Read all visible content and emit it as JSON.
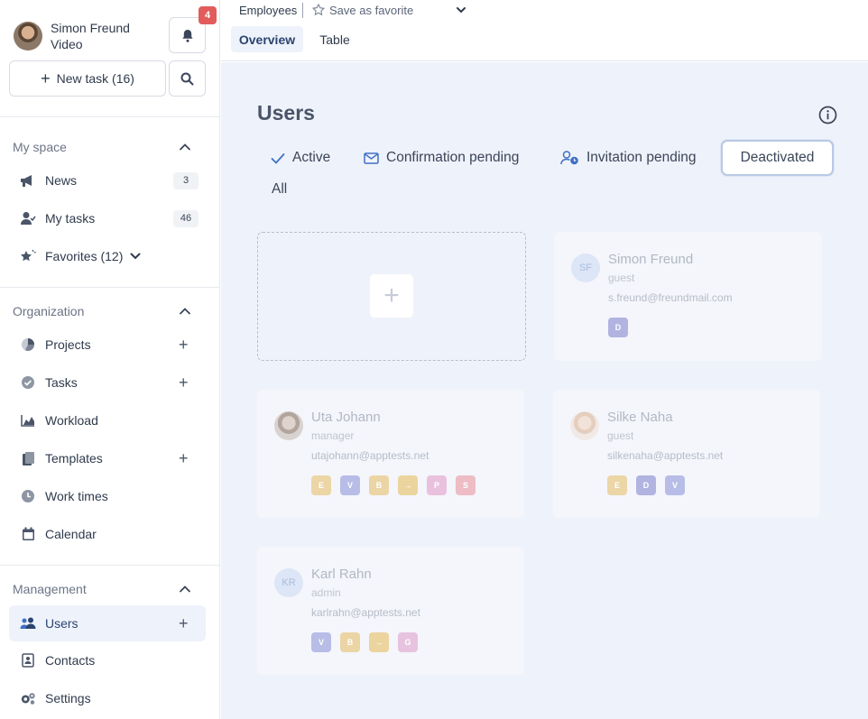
{
  "profile": {
    "name": "Simon Freund",
    "subtitle": "Video"
  },
  "notifications": {
    "count": "4"
  },
  "new_task_label": "New task (16)",
  "sections": {
    "my_space": "My space",
    "organization": "Organization",
    "management": "Management"
  },
  "nav": {
    "news": {
      "label": "News",
      "count": "3"
    },
    "my_tasks": {
      "label": "My tasks",
      "count": "46"
    },
    "favorites": {
      "label": "Favorites (12)"
    },
    "projects": {
      "label": "Projects"
    },
    "tasks": {
      "label": "Tasks"
    },
    "workload": {
      "label": "Workload"
    },
    "templates": {
      "label": "Templates"
    },
    "work_times": {
      "label": "Work times"
    },
    "calendar": {
      "label": "Calendar"
    },
    "users": {
      "label": "Users"
    },
    "contacts": {
      "label": "Contacts"
    },
    "settings": {
      "label": "Settings"
    }
  },
  "header": {
    "breadcrumb": "Employees",
    "save_favorite": "Save as favorite",
    "tabs": [
      "Overview",
      "Table"
    ]
  },
  "page": {
    "title": "Users",
    "filters": {
      "active": "Active",
      "confirmation_pending": "Confirmation pending",
      "invitation_pending": "Invitation pending",
      "deactivated": "Deactivated",
      "all": "All"
    }
  },
  "users": [
    {
      "initials": "SF",
      "name": "Simon Freund",
      "role": "guest",
      "email": "s.freund@freundmail.com",
      "chips": [
        {
          "letter": "D",
          "color": "#b1b4e0"
        }
      ]
    },
    {
      "initials": "",
      "name": "Uta Johann",
      "role": "manager",
      "email": "utajohann@apptests.net",
      "chips": [
        {
          "letter": "E",
          "color": "#ecd6a6"
        },
        {
          "letter": "V",
          "color": "#b7bde6"
        },
        {
          "letter": "B",
          "color": "#ebd5a5"
        },
        {
          "letter": "→",
          "color": "#ebd49e"
        },
        {
          "letter": "P",
          "color": "#e9c1df"
        },
        {
          "letter": "S",
          "color": "#eebcc4"
        }
      ]
    },
    {
      "initials": "",
      "name": "Silke Naha",
      "role": "guest",
      "email": "silkenaha@apptests.net",
      "chips": [
        {
          "letter": "E",
          "color": "#ecd6a6"
        },
        {
          "letter": "D",
          "color": "#b1b4e0"
        },
        {
          "letter": "V",
          "color": "#b7bde6"
        }
      ]
    },
    {
      "initials": "KR",
      "name": "Karl Rahn",
      "role": "admin",
      "email": "karlrahn@apptests.net",
      "chips": [
        {
          "letter": "V",
          "color": "#b7bde6"
        },
        {
          "letter": "B",
          "color": "#ebd5a5"
        },
        {
          "letter": "→",
          "color": "#ebd49e"
        },
        {
          "letter": "G",
          "color": "#e7c3df"
        }
      ]
    }
  ],
  "colors": {
    "accent": "#3e6fc4",
    "badge": "#e25c5c",
    "main_bg": "#eef2fa",
    "selected_border": "#b9c9e4"
  }
}
